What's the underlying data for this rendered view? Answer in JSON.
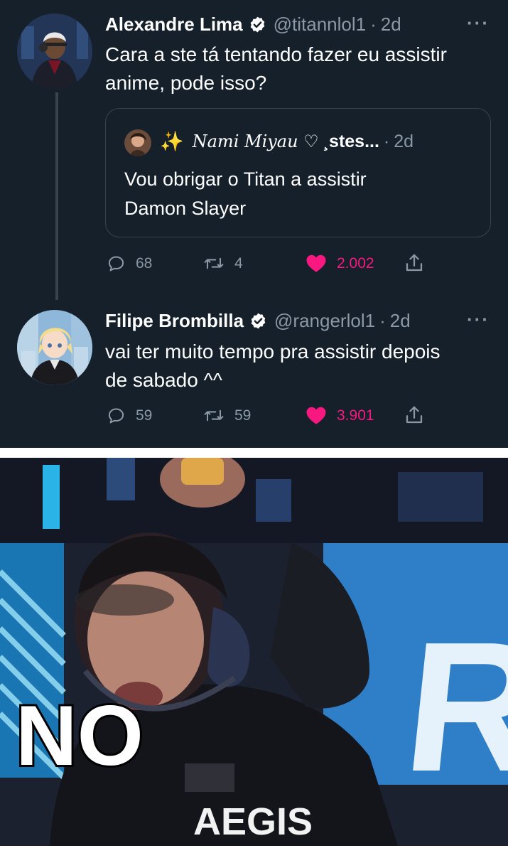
{
  "tweets": [
    {
      "name": "Alexandre Lima",
      "handle": "@titannlol1",
      "separator": "·",
      "time": "2d",
      "text_lines": [
        "Cara a ste tá tentando fazer eu assistir",
        "anime, pode isso?"
      ],
      "quote": {
        "name": "Nami Miyau ♡",
        "handle_fragment": "¸stes...",
        "time": "2d",
        "text_lines": [
          "Vou obrigar o Titan a assistir",
          "Damon Slayer"
        ]
      },
      "actions": {
        "replies": "68",
        "retweets": "4",
        "likes": "2.002"
      }
    },
    {
      "name": "Filipe Brombilla",
      "handle": "@rangerlol1",
      "separator": "·",
      "time": "2d",
      "text_lines": [
        "vai ter muito tempo pra assistir depois",
        "de sabado ^^"
      ],
      "actions": {
        "replies": "59",
        "retweets": "59",
        "likes": "3.901"
      }
    }
  ],
  "meme": {
    "caption": "NO",
    "jersey_text": "AEGIS",
    "banner_text": "RED"
  },
  "icons": {
    "more": "more-horizontal-icon",
    "verified": "verified-badge-icon",
    "reply": "reply-icon",
    "retweet": "retweet-icon",
    "like": "heart-icon",
    "share": "share-icon",
    "sparkles": "sparkles-icon"
  },
  "colors": {
    "background": "#15202b",
    "text": "#ffffff",
    "secondary_text": "#8b98a5",
    "border": "#38444d",
    "like": "#f91880"
  }
}
